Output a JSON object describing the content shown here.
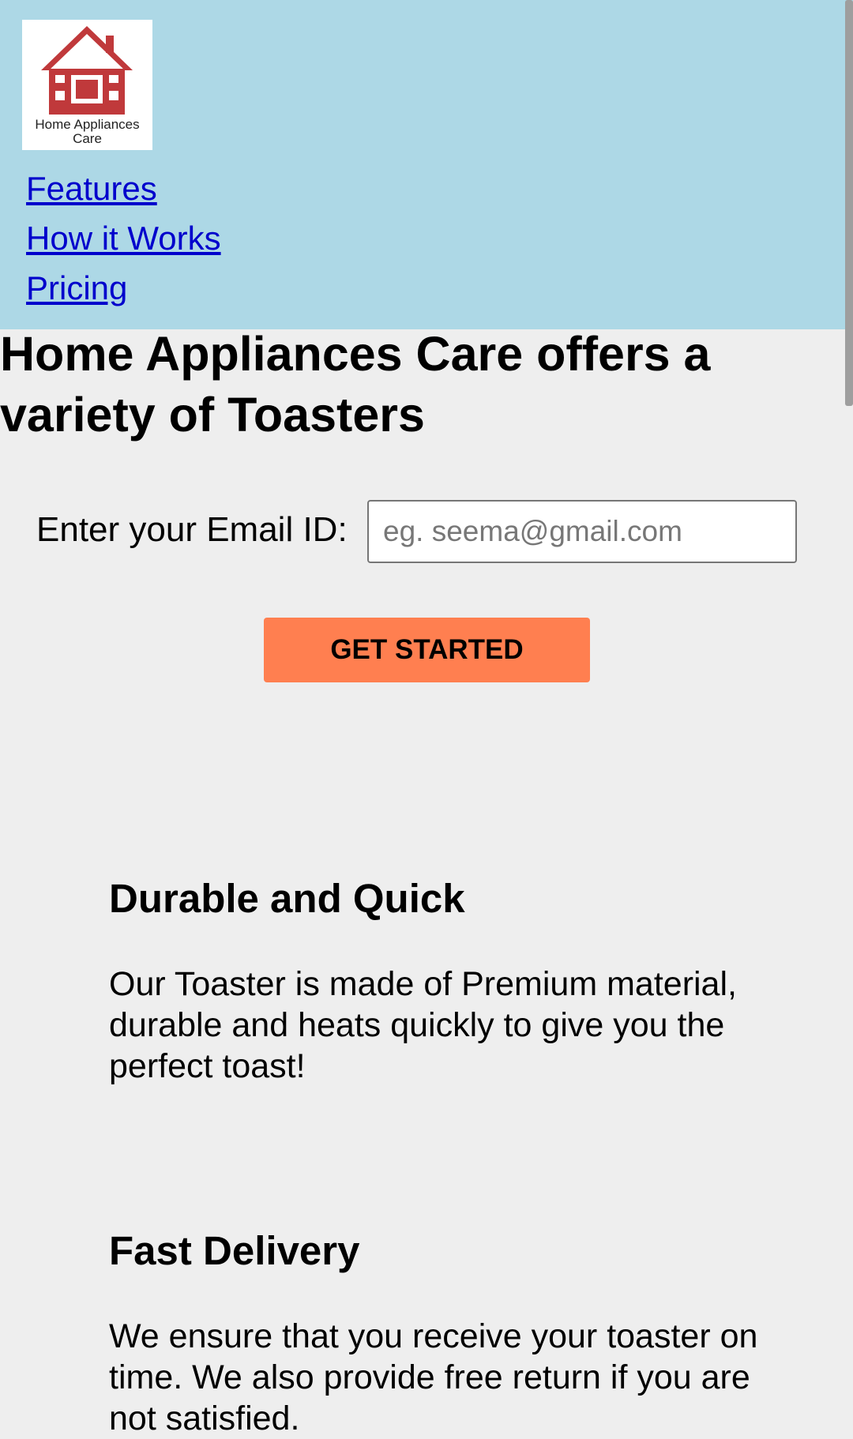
{
  "header": {
    "logo_text": "Home Appliances Care",
    "nav": [
      "Features",
      "How it Works",
      "Pricing"
    ]
  },
  "hero": {
    "title": "Home Appliances Care offers a variety of Toasters"
  },
  "signup": {
    "label": "Enter your Email ID:",
    "placeholder": "eg. seema@gmail.com",
    "button": "GET STARTED"
  },
  "features": [
    {
      "title": "Durable and Quick",
      "text": "Our Toaster is made of Premium material, durable and heats quickly to give you the perfect toast!"
    },
    {
      "title": "Fast Delivery",
      "text": "We ensure that you receive your toaster on time. We also provide free return if you are not satisfied."
    }
  ],
  "colors": {
    "header_bg": "#add8e6",
    "page_bg": "#eeeeee",
    "cta_bg": "#ff7f50",
    "link": "#0000cc",
    "logo_red": "#c0393b"
  }
}
